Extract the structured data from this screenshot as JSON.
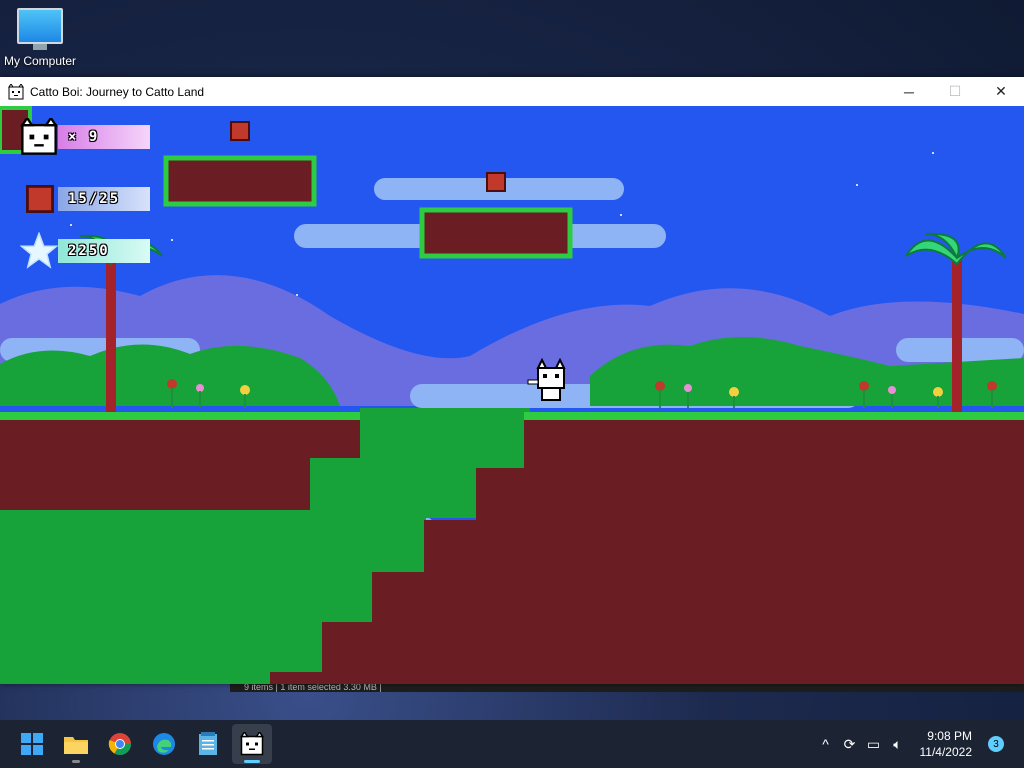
{
  "desktop": {
    "icons": [
      {
        "label": "My Computer",
        "icon": "monitor-icon"
      }
    ]
  },
  "window": {
    "title": "Catto Boi: Journey to Catto Land",
    "controls": {
      "minimize": "─",
      "maximize": "☐",
      "close": "✕"
    }
  },
  "game": {
    "hud": {
      "lives": {
        "icon": "cat-face-icon",
        "text": "× 9"
      },
      "gems": {
        "icon": "red-gem-icon",
        "text": "15/25"
      },
      "score": {
        "icon": "star-icon",
        "text": "2250"
      }
    },
    "colors": {
      "sky": "#2457f0",
      "dirt": "#6b1d24",
      "grass": "#2ecc40",
      "bush": "#18a33a",
      "cloud": "#8fb4f5"
    }
  },
  "background_window": {
    "status_text": "9 items  |  1 item selected  3.30 MB  |"
  },
  "taskbar": {
    "apps": [
      {
        "name": "start",
        "icon": "windows-start-icon"
      },
      {
        "name": "file-explorer",
        "icon": "folder-icon"
      },
      {
        "name": "chrome",
        "icon": "chrome-icon"
      },
      {
        "name": "edge",
        "icon": "edge-icon"
      },
      {
        "name": "notepad",
        "icon": "notepad-icon"
      },
      {
        "name": "catto-boi",
        "icon": "cat-face-icon",
        "active": true
      }
    ],
    "tray": {
      "time": "9:08 PM",
      "date": "11/4/2022",
      "notifications": "3"
    }
  }
}
